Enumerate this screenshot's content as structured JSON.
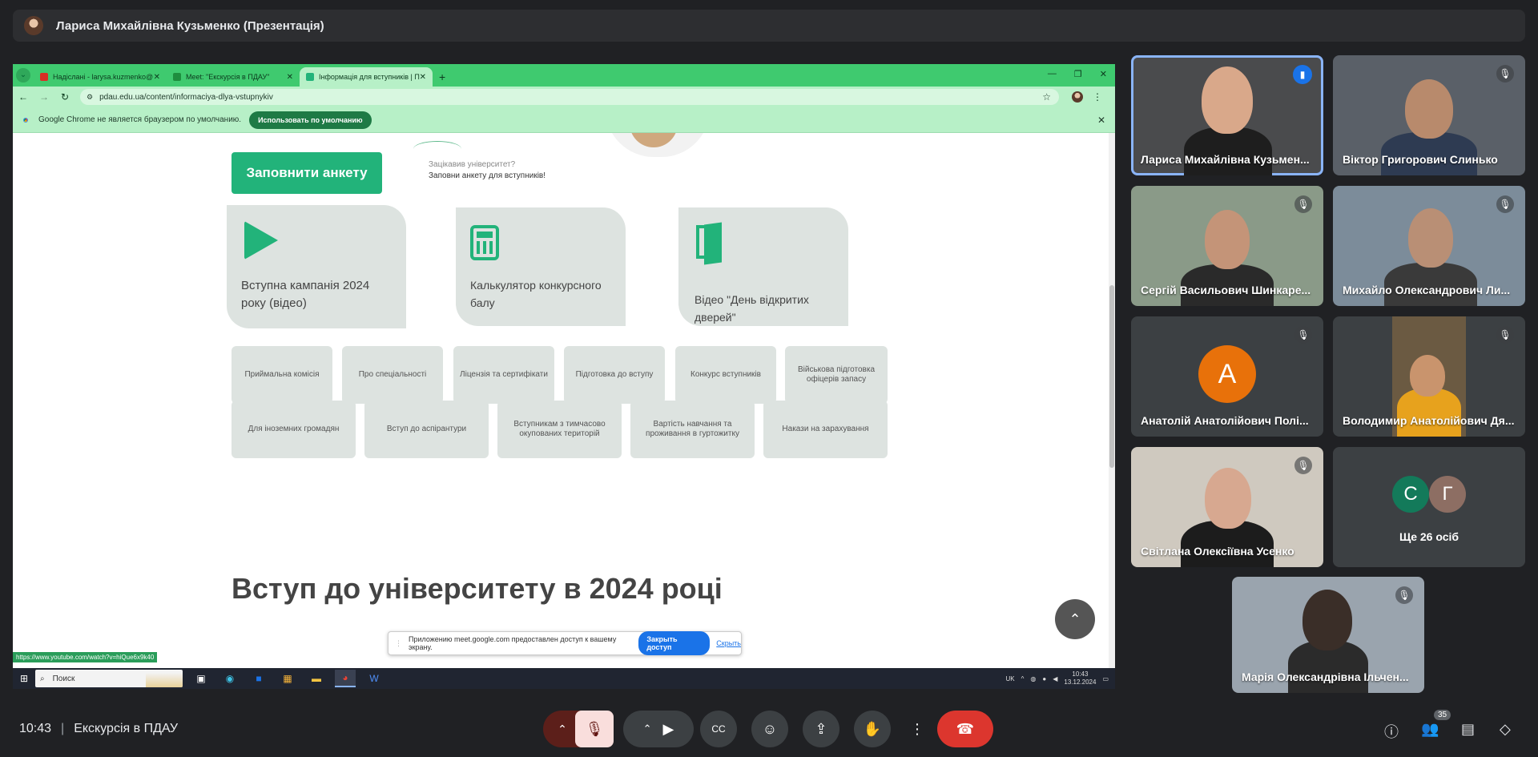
{
  "meet": {
    "presenter_title": "Лариса Михайлівна Кузьменко (Презентація)",
    "time": "10:43",
    "meeting_title": "Екскурсія в ПДАУ",
    "people_count": "35"
  },
  "browser": {
    "tabs": [
      {
        "label": "Надіслані - larysa.kuzmenko@",
        "color": "#d93025"
      },
      {
        "label": "Meet: \"Екскурсія в ПДАУ\"",
        "color": "#1e8e3e"
      },
      {
        "label": "Інформація для вступників | П",
        "color": "#22b37a"
      }
    ],
    "url": "pdau.edu.ua/content/informaciya-dlya-vstupnykiv",
    "infobar_text": "Google Chrome не является браузером по умолчанию.",
    "infobar_button": "Использовать по умолчанию",
    "status_url": "https://www.youtube.com/watch?v=hiQue6x9k40"
  },
  "page": {
    "fill_form_button": "Заповнити анкету",
    "hint_question": "Зацікавив університет?",
    "hint_action": "Заповни анкету для вступників!",
    "cards": [
      {
        "label": "Вступна кампанія 2024 року (відео)",
        "icon": "play-icon"
      },
      {
        "label": "Калькулятор конкурсного балу",
        "icon": "calculator-icon"
      },
      {
        "label": "Відео \"День відкритих дверей\"",
        "icon": "door-icon"
      }
    ],
    "links_row1": [
      "Приймальна комісія",
      "Про спеціальності",
      "Ліцензія та сертифікати",
      "Підготовка до вступу",
      "Конкурс вступників",
      "Військова підготовка офіцерів запасу"
    ],
    "links_row2": [
      "Для іноземних громадян",
      "Вступ до аспірантури",
      "Вступникам з тимчасово окупованих територій",
      "Вартість навчання та проживання в гуртожитку",
      "Накази на зарахування"
    ],
    "section_heading": "Вступ до університету в 2024 році",
    "accent_color": "#22b37a"
  },
  "share_notice": {
    "text": "Приложению meet.google.com предоставлен доступ к вашему экрану.",
    "stop_button": "Закрыть доступ",
    "hide_link": "Скрыть"
  },
  "taskbar": {
    "search_placeholder": "Поиск",
    "lang": "UK",
    "time": "10:43",
    "date": "13.12.2024"
  },
  "participants": [
    {
      "name": "Лариса Михайлівна Кузьмен...",
      "speaking": true
    },
    {
      "name": "Віктор Григорович Слинько",
      "speaking": false
    },
    {
      "name": "Сергій Васильович Шинкаре...",
      "speaking": false
    },
    {
      "name": "Михайло Олександрович Ли...",
      "speaking": false
    },
    {
      "name": "Анатолій Анатолійович Полі...",
      "speaking": false,
      "initial": "А"
    },
    {
      "name": "Володимир Анатолійович Дя...",
      "speaking": false
    },
    {
      "name": "Світлана Олексіївна Усенко",
      "speaking": false
    },
    {
      "name": "Марія Олександрівна Ільчен...",
      "speaking": false
    }
  ],
  "more": {
    "initials": [
      "С",
      "Г"
    ],
    "label": "Ще 26 осіб"
  }
}
